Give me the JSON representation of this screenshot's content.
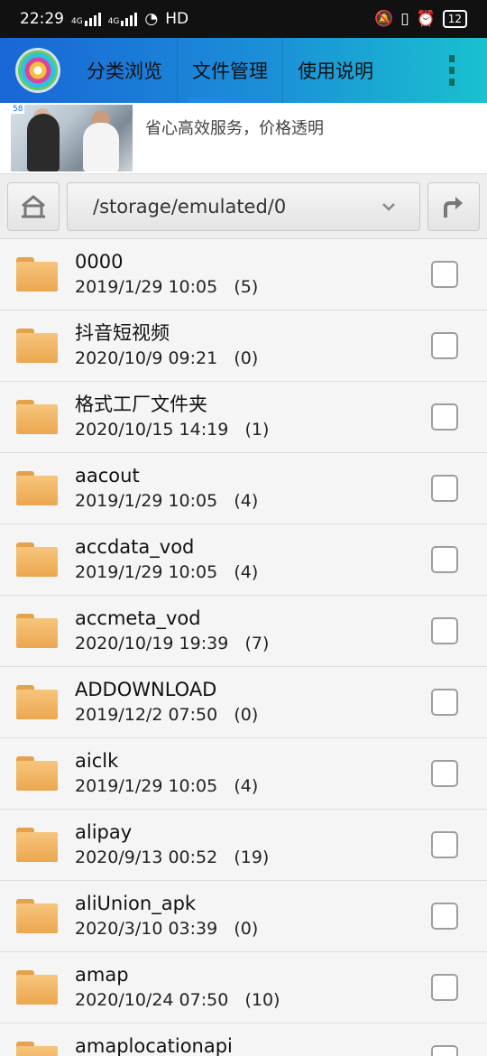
{
  "status": {
    "time": "22:29",
    "net1": "4G",
    "net2": "4G",
    "hd": "HD",
    "battery": "12"
  },
  "tabs": [
    {
      "label": "分类浏览"
    },
    {
      "label": "文件管理",
      "active": true
    },
    {
      "label": "使用说明"
    }
  ],
  "ad": {
    "badge": "58",
    "text": "省心高效服务，价格透明"
  },
  "path": {
    "current": "/storage/emulated/0"
  },
  "files": [
    {
      "name": "0000",
      "date": "2019/1/29 10:05",
      "count": "(5)"
    },
    {
      "name": "抖音短视频",
      "date": "2020/10/9 09:21",
      "count": "(0)"
    },
    {
      "name": "格式工厂文件夹",
      "date": "2020/10/15 14:19",
      "count": "(1)"
    },
    {
      "name": "aacout",
      "date": "2019/1/29 10:05",
      "count": "(4)"
    },
    {
      "name": "accdata_vod",
      "date": "2019/1/29 10:05",
      "count": "(4)"
    },
    {
      "name": "accmeta_vod",
      "date": "2020/10/19 19:39",
      "count": "(7)"
    },
    {
      "name": "ADDOWNLOAD",
      "date": "2019/12/2 07:50",
      "count": "(0)"
    },
    {
      "name": "aiclk",
      "date": "2019/1/29 10:05",
      "count": "(4)"
    },
    {
      "name": "alipay",
      "date": "2020/9/13 00:52",
      "count": "(19)"
    },
    {
      "name": "aliUnion_apk",
      "date": "2020/3/10 03:39",
      "count": "(0)"
    },
    {
      "name": "amap",
      "date": "2020/10/24 07:50",
      "count": "(10)"
    },
    {
      "name": "amaplocationapi",
      "date": "",
      "count": ""
    }
  ]
}
